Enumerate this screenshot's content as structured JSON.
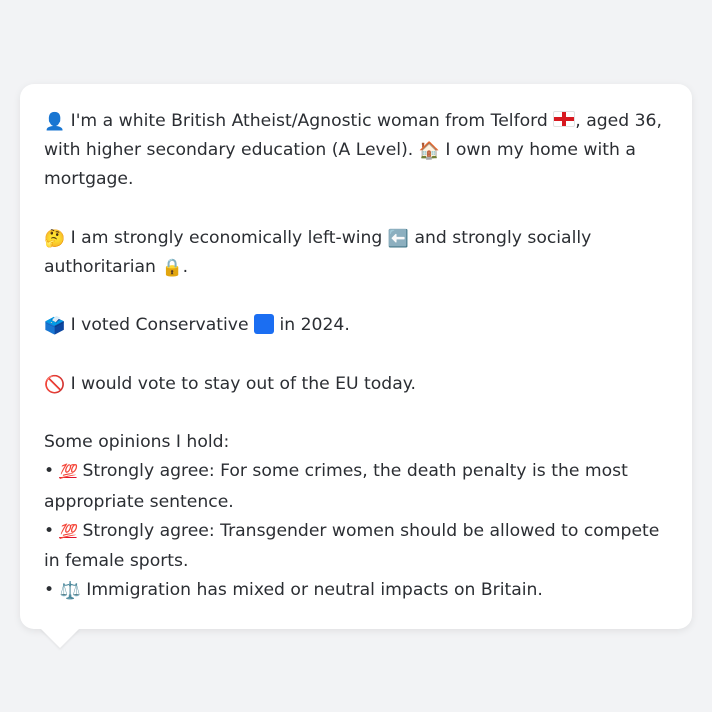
{
  "profile": {
    "line1_prefix": "I'm a white British Atheist/Agnostic woman from Telford",
    "line1_suffix": ", aged 36, with higher secondary education (A Level).",
    "line1_tail": "I own my home with a mortgage.",
    "economic_prefix": "I am strongly economically left-wing",
    "economic_suffix": "and strongly socially authoritarian",
    "economic_end": ".",
    "vote_prefix": "I voted Conservative",
    "vote_suffix": "in 2024.",
    "eu_text": "I would vote to stay out of the EU today.",
    "opinions_heading": "Some opinions I hold:",
    "opinions": [
      {
        "bullet": "•",
        "text": "Strongly agree: For some crimes, the death penalty is the most appropriate sentence."
      },
      {
        "bullet": "•",
        "text": "Strongly agree: Transgender women should be allowed to compete in female sports."
      },
      {
        "bullet": "•",
        "text": "Immigration has mixed or neutral impacts on Britain."
      }
    ]
  },
  "icons": {
    "person": "👤",
    "house": "🏠",
    "thinking": "🤔",
    "left_arrow": "⬅️",
    "lock": "🔒",
    "ballot": "🗳️",
    "prohibited": "🚫",
    "hundred": "💯",
    "scales": "⚖️"
  },
  "colors": {
    "background": "#f2f3f5",
    "card": "#ffffff",
    "text": "#2b2e33",
    "conservative_blue": "#1b6ef2",
    "england_red": "#d71920"
  }
}
